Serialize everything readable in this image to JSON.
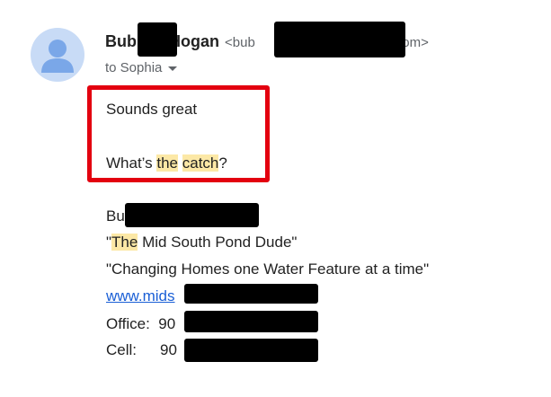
{
  "email": {
    "sender_name_visible_start": "Bub",
    "sender_name_visible_end": "Hogan",
    "sender_email_visible_start": "<bub",
    "sender_email_visible_end": "ds.com>",
    "to_label": "to Sophia",
    "message_line1": "Sounds great",
    "message_line2_before": "What’s ",
    "message_line2_hl1": "the",
    "message_line2_mid": " ",
    "message_line2_hl2": "catch",
    "message_line2_after": "?"
  },
  "signature": {
    "name_visible": "Bu",
    "tagline_quote_open": "\"",
    "tagline_hl": "The",
    "tagline_rest": " Mid South Pond Dude\"",
    "motto": "\"Changing Homes one Water Feature at a time\"",
    "website_visible": "www.mids",
    "office_label": "Office:",
    "office_visible": "90",
    "cell_label": "Cell:",
    "cell_visible": "90"
  },
  "icons": {
    "avatar": "person-avatar-icon",
    "dropdown": "chevron-down-icon"
  },
  "colors": {
    "highlight_border": "#e3000f",
    "search_highlight": "#fce8a6",
    "link": "#1a5fd6",
    "avatar_bg": "#c8dbf6",
    "avatar_fg": "#7aa7e8"
  }
}
